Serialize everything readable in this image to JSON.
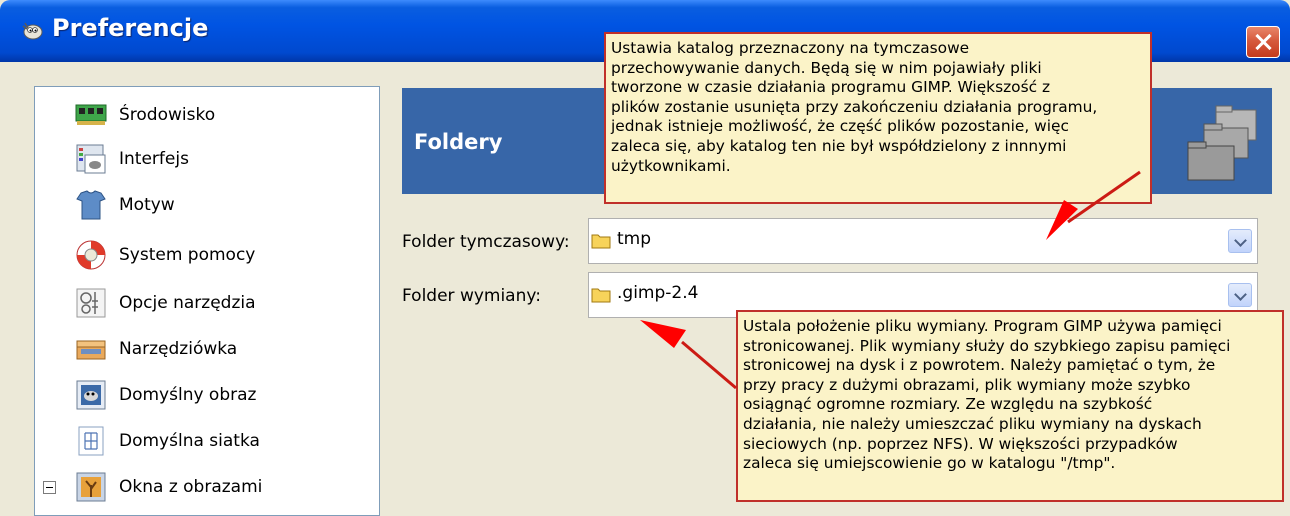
{
  "window": {
    "title": "Preferencje",
    "close_icon": "close-icon"
  },
  "sidebar": {
    "items": [
      {
        "label": "Środowisko",
        "icon": "memory-chip-icon"
      },
      {
        "label": "Interfejs",
        "icon": "interface-window-icon"
      },
      {
        "label": "Motyw",
        "icon": "theme-shirt-icon"
      },
      {
        "label": "System pomocy",
        "icon": "lifebuoy-icon"
      },
      {
        "label": "Opcje narzędzia",
        "icon": "tool-options-icon"
      },
      {
        "label": "Narzędziówka",
        "icon": "toolbox-icon"
      },
      {
        "label": "Domyślny obraz",
        "icon": "default-image-icon"
      },
      {
        "label": "Domyślna siatka",
        "icon": "grid-icon"
      },
      {
        "label": "Okna z obrazami",
        "icon": "image-windows-icon"
      }
    ]
  },
  "header": {
    "title": "Foldery",
    "icon": "folders-icon",
    "color": "#3766a8"
  },
  "fields": {
    "temp_label": "Folder tymczasowy:",
    "temp_value": "tmp",
    "swap_label": "Folder wymiany:",
    "swap_value": ".gimp-2.4"
  },
  "callouts": {
    "temp_text": "Ustawia katalog przeznaczony na tymczasowe\nprzechowywanie danych. Będą się w nim pojawiały pliki\ntworzone w czasie działania programu GIMP. Większość z\nplików zostanie usunięta przy zakończeniu działania programu,\njednak istnieje możliwość, że część plików pozostanie, więc\nzaleca się, aby katalog ten nie był współdzielony z innnymi\nużytkownikami.",
    "swap_text": "Ustala położenie pliku wymiany. Program GIMP używa pamięci\nstronicowanej. Plik wymiany służy do szybkiego zapisu pamięci\nstronicowej na dysk i z powrotem. Należy pamiętać o tym, że\nprzy pracy z dużymi obrazami, plik wymiany może szybko\nosiągnąć ogromne rozmiary. Ze względu na szybkość\ndziałania, nie należy umieszczać pliku wymiany na dyskach\nsieciowych (np. poprzez NFS). W większości przypadków\nzaleca się umiejscowienie go w katalogu \"/tmp\".",
    "border_color": "#c0302a",
    "background_color": "#fbf3c8"
  }
}
